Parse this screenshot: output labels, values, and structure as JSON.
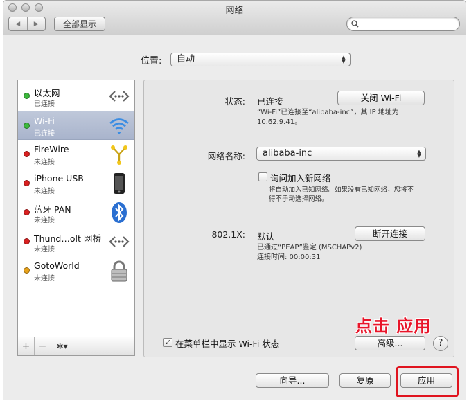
{
  "window": {
    "title": "网络"
  },
  "toolbar": {
    "back_glyph": "◀",
    "forward_glyph": "▶",
    "show_all_label": "全部显示",
    "search_placeholder": ""
  },
  "location": {
    "label": "位置:",
    "value": "自动"
  },
  "services": [
    {
      "name": "以太网",
      "status": "已连接",
      "dot_color": "#3cb83c",
      "icon": "ethernet-icon"
    },
    {
      "name": "Wi-Fi",
      "status": "已连接",
      "dot_color": "#3cb83c",
      "icon": "wifi-icon"
    },
    {
      "name": "FireWire",
      "status": "未连接",
      "dot_color": "#d92020",
      "icon": "firewire-icon"
    },
    {
      "name": "iPhone USB",
      "status": "未连接",
      "dot_color": "#d92020",
      "icon": "iphone-icon"
    },
    {
      "name": "蓝牙 PAN",
      "status": "未连接",
      "dot_color": "#d92020",
      "icon": "bluetooth-icon"
    },
    {
      "name": "Thund…olt 网桥",
      "status": "未连接",
      "dot_color": "#d92020",
      "icon": "thunderbolt-bridge-icon"
    },
    {
      "name": "GotoWorld",
      "status": "未连接",
      "dot_color": "#e8a21a",
      "icon": "lock-icon"
    }
  ],
  "sidebar_buttons": {
    "add": "+",
    "remove": "−",
    "gear": "✲▾"
  },
  "detail": {
    "status_label": "状态:",
    "status_value": "已连接",
    "turn_off_button": "关闭 Wi-Fi",
    "status_note_1": "“Wi-Fi”已连接至“alibaba-inc”，其 IP 地址为",
    "status_note_2": "10.62.9.41。",
    "network_name_label": "网络名称:",
    "network_name_value": "alibaba-inc",
    "ask_join_label": "询问加入新网络",
    "ask_join_checked": false,
    "ask_join_note_1": "将自动加入已知网络。如果没有已知网络，您将不",
    "ask_join_note_2": "得不手动选择网络。",
    "auth_label": "802.1X:",
    "auth_value": "默认",
    "disconnect_button": "断开连接",
    "auth_note_1": "已通过“PEAP”鉴定 (MSCHAPv2)",
    "auth_note_2": "连接时间:  00:00:31",
    "show_menu_label": "在菜单栏中显示 Wi-Fi 状态",
    "show_menu_checked": true,
    "advanced_button": "高级...",
    "help_button": "?"
  },
  "footer": {
    "assist_button": "向导...",
    "revert_button": "复原",
    "apply_button": "应用"
  },
  "annotation": {
    "text": "点击 应用",
    "color": "#e8152a"
  }
}
